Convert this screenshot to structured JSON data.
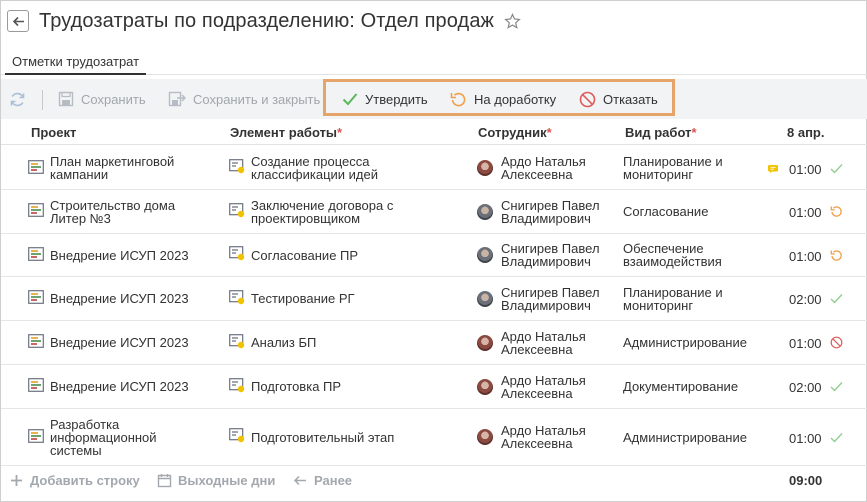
{
  "header": {
    "title": "Трудозатраты по подразделению: Отдел продаж"
  },
  "tabs": [
    {
      "label": "Отметки трудозатрат"
    }
  ],
  "toolbar": {
    "save": "Сохранить",
    "save_close": "Сохранить и закрыть",
    "approve": "Утвердить",
    "rework": "На доработку",
    "reject": "Отказать"
  },
  "columns": {
    "project": "Проект",
    "element": "Элемент работы",
    "employee": "Сотрудник",
    "work_type": "Вид работ",
    "date": "8 апр.",
    "required_mark": "*"
  },
  "rows": [
    {
      "project": "План маркетинговой кампании",
      "element": "Создание процесса классификации идей",
      "employee": "Ардо Наталья Алексеевна",
      "work_type": "Планирование и мониторинг",
      "hours": "01:00",
      "status": "approved",
      "has_note": true
    },
    {
      "project": "Строительство дома Литер №3",
      "element": "Заключение договора с проектировщиком",
      "employee": "Снигирев Павел Владимирович",
      "work_type": "Согласование",
      "hours": "01:00",
      "status": "rework",
      "has_note": false
    },
    {
      "project": "Внедрение ИСУП 2023",
      "element": "Согласование ПР",
      "employee": "Снигирев Павел Владимирович",
      "work_type": "Обеспечение взаимодействия",
      "hours": "01:00",
      "status": "rework",
      "has_note": false
    },
    {
      "project": "Внедрение ИСУП 2023",
      "element": "Тестирование РГ",
      "employee": "Снигирев Павел Владимирович",
      "work_type": "Планирование и мониторинг",
      "hours": "02:00",
      "status": "approved",
      "has_note": false
    },
    {
      "project": "Внедрение ИСУП 2023",
      "element": "Анализ БП",
      "employee": "Ардо Наталья Алексеевна",
      "work_type": "Администрирование",
      "hours": "01:00",
      "status": "rejected",
      "has_note": false
    },
    {
      "project": "Внедрение ИСУП 2023",
      "element": "Подготовка ПР",
      "employee": "Ардо Наталья Алексеевна",
      "work_type": "Документирование",
      "hours": "02:00",
      "status": "approved",
      "has_note": false
    },
    {
      "project": "Разработка информационной системы",
      "element": "Подготовительный этап",
      "employee": "Ардо Наталья Алексеевна",
      "work_type": "Администрирование",
      "hours": "01:00",
      "status": "approved",
      "has_note": false
    }
  ],
  "footer": {
    "add_row": "Добавить строку",
    "weekends": "Выходные дни",
    "earlier": "Ранее",
    "total": "09:00"
  },
  "colors": {
    "approve": "#5cb85c",
    "rework": "#f0a04b",
    "reject": "#e05a5a",
    "highlight": "#e5a56a",
    "note": "#f2c200"
  }
}
